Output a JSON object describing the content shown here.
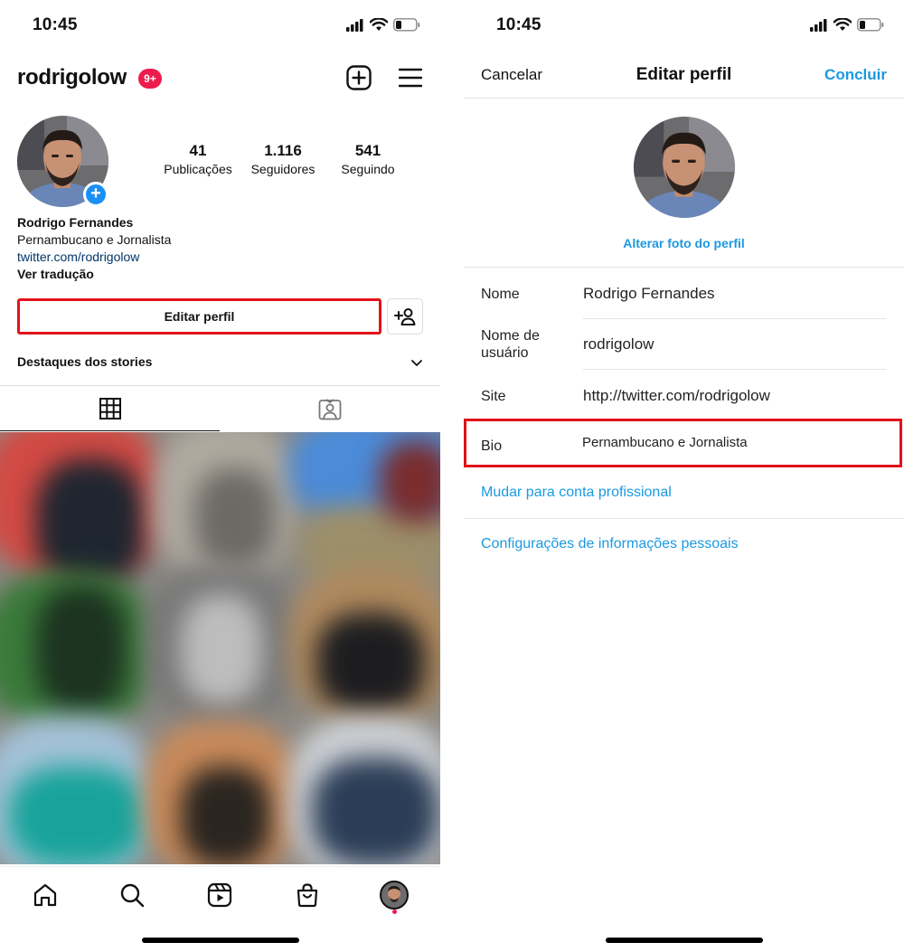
{
  "status_bar": {
    "time": "10:45"
  },
  "profile": {
    "username": "rodrigolow",
    "notification_badge": "9+",
    "stats": [
      {
        "value": "41",
        "label": "Publicações"
      },
      {
        "value": "1.116",
        "label": "Seguidores"
      },
      {
        "value": "541",
        "label": "Seguindo"
      }
    ],
    "full_name": "Rodrigo Fernandes",
    "bio": "Pernambucano e Jornalista",
    "link": "twitter.com/rodrigolow",
    "translate": "Ver tradução",
    "edit_profile_label": "Editar perfil",
    "highlights_label": "Destaques dos stories"
  },
  "bottom_nav": [
    "home-icon",
    "search-icon",
    "reels-icon",
    "shop-icon",
    "profile-avatar"
  ],
  "edit_profile": {
    "cancel_label": "Cancelar",
    "title": "Editar perfil",
    "done_label": "Concluir",
    "change_photo_label": "Alterar foto do perfil",
    "fields": {
      "name_label": "Nome",
      "name_value": "Rodrigo Fernandes",
      "username_label": "Nome de usuário",
      "username_value": "rodrigolow",
      "site_label": "Site",
      "site_value": "http://twitter.com/rodrigolow",
      "bio_label": "Bio",
      "bio_value": "Pernambucano e Jornalista"
    },
    "switch_professional_label": "Mudar para conta profissional",
    "personal_info_label": "Configurações de informações pessoais"
  },
  "colors": {
    "accent_blue": "#1a9ae0",
    "highlight_red": "#e2121a",
    "badge_red": "#ed1c4d"
  }
}
